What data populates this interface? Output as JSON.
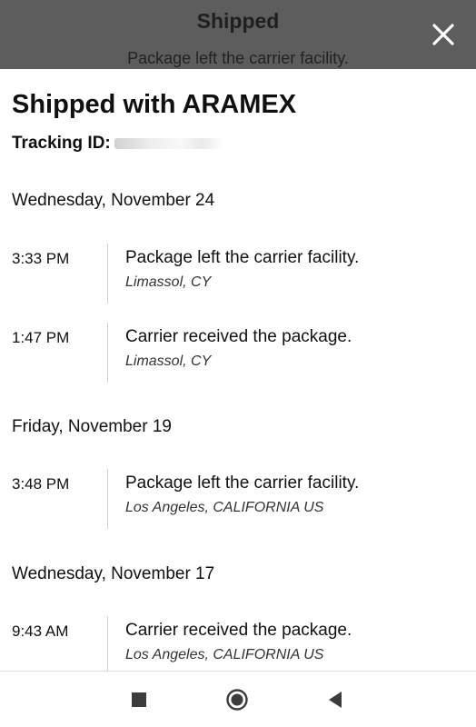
{
  "header": {
    "title": "Shipped",
    "subtitle": "Package left the carrier facility."
  },
  "sheet": {
    "carrier_title": "Shipped with ARAMEX",
    "tracking_label": "Tracking ID:"
  },
  "days": [
    {
      "date": "Wednesday, November 24",
      "events": [
        {
          "time": "3:33 PM",
          "status": "Package left the carrier facility.",
          "location": "Limassol, CY"
        },
        {
          "time": "1:47 PM",
          "status": "Carrier received the package.",
          "location": "Limassol, CY"
        }
      ]
    },
    {
      "date": "Friday, November 19",
      "events": [
        {
          "time": "3:48 PM",
          "status": "Package left the carrier facility.",
          "location": "Los Angeles, CALIFORNIA US"
        }
      ]
    },
    {
      "date": "Wednesday, November 17",
      "events": [
        {
          "time": "9:43 AM",
          "status": "Carrier received the package.",
          "location": "Los Angeles, CALIFORNIA US"
        }
      ]
    }
  ],
  "icons": {
    "close": "close-icon",
    "nav_recents": "square-icon",
    "nav_home": "circle-icon",
    "nav_back": "triangle-back-icon"
  }
}
